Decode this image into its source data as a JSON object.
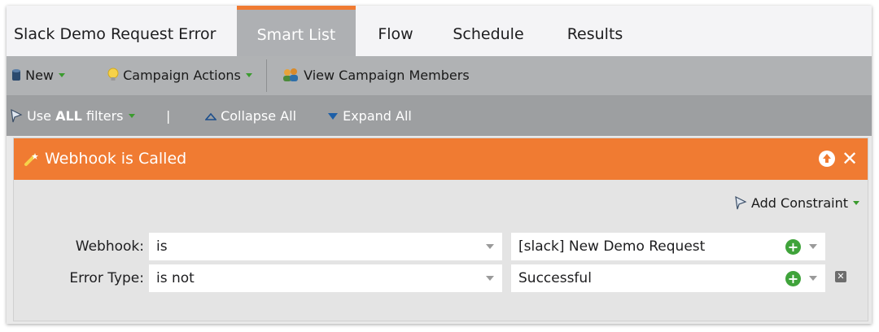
{
  "header": {
    "title": "Slack Demo Request Error",
    "tabs": [
      {
        "label": "Smart List",
        "active": true
      },
      {
        "label": "Flow",
        "active": false
      },
      {
        "label": "Schedule",
        "active": false
      },
      {
        "label": "Results",
        "active": false
      }
    ]
  },
  "toolbar": {
    "new_label": "New",
    "campaign_actions_label": "Campaign Actions",
    "view_members_label": "View Campaign Members"
  },
  "filter_toolbar": {
    "use_prefix": "Use",
    "use_bold": "ALL",
    "use_suffix": "filters",
    "divider": "|",
    "collapse_label": "Collapse All",
    "expand_label": "Expand All"
  },
  "filter": {
    "title": "Webhook is Called",
    "add_constraint_label": "Add Constraint",
    "rows": [
      {
        "label": "Webhook:",
        "operator": "is",
        "value": "[slack] New Demo Request"
      },
      {
        "label": "Error Type:",
        "operator": "is not",
        "value": "Successful"
      }
    ]
  },
  "colors": {
    "accent": "#f07b32",
    "active_tab": "#aeb0b3",
    "add_green": "#3fa33a"
  },
  "icons": {
    "new": "db-icon",
    "campaign_actions": "lightbulb-icon",
    "view_members": "people-icon",
    "filter": "filter-icon",
    "collapse": "triangle-up-icon",
    "expand": "triangle-down-icon",
    "webhook": "wand-icon",
    "move_up": "arrow-up-circle-icon",
    "close": "close-icon",
    "add": "plus-circle-icon",
    "delete": "delete-box-icon"
  }
}
